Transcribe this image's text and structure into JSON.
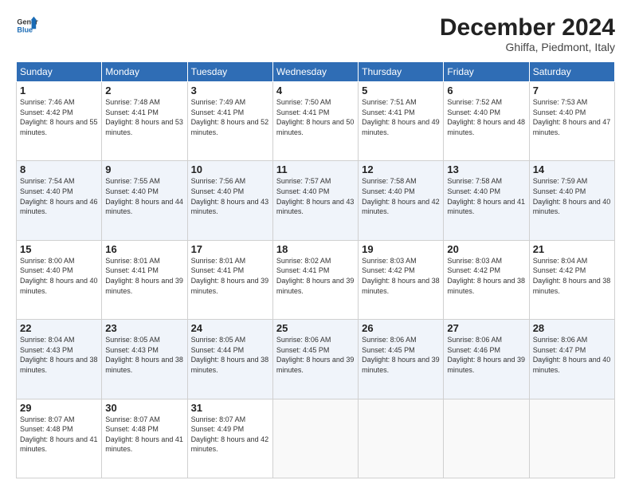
{
  "header": {
    "logo_line1": "General",
    "logo_line2": "Blue",
    "title": "December 2024",
    "subtitle": "Ghiffa, Piedmont, Italy"
  },
  "days_of_week": [
    "Sunday",
    "Monday",
    "Tuesday",
    "Wednesday",
    "Thursday",
    "Friday",
    "Saturday"
  ],
  "weeks": [
    [
      {
        "num": "1",
        "sunrise": "7:46 AM",
        "sunset": "4:42 PM",
        "daylight": "8 hours and 55 minutes."
      },
      {
        "num": "2",
        "sunrise": "7:48 AM",
        "sunset": "4:41 PM",
        "daylight": "8 hours and 53 minutes."
      },
      {
        "num": "3",
        "sunrise": "7:49 AM",
        "sunset": "4:41 PM",
        "daylight": "8 hours and 52 minutes."
      },
      {
        "num": "4",
        "sunrise": "7:50 AM",
        "sunset": "4:41 PM",
        "daylight": "8 hours and 50 minutes."
      },
      {
        "num": "5",
        "sunrise": "7:51 AM",
        "sunset": "4:41 PM",
        "daylight": "8 hours and 49 minutes."
      },
      {
        "num": "6",
        "sunrise": "7:52 AM",
        "sunset": "4:40 PM",
        "daylight": "8 hours and 48 minutes."
      },
      {
        "num": "7",
        "sunrise": "7:53 AM",
        "sunset": "4:40 PM",
        "daylight": "8 hours and 47 minutes."
      }
    ],
    [
      {
        "num": "8",
        "sunrise": "7:54 AM",
        "sunset": "4:40 PM",
        "daylight": "8 hours and 46 minutes."
      },
      {
        "num": "9",
        "sunrise": "7:55 AM",
        "sunset": "4:40 PM",
        "daylight": "8 hours and 44 minutes."
      },
      {
        "num": "10",
        "sunrise": "7:56 AM",
        "sunset": "4:40 PM",
        "daylight": "8 hours and 43 minutes."
      },
      {
        "num": "11",
        "sunrise": "7:57 AM",
        "sunset": "4:40 PM",
        "daylight": "8 hours and 43 minutes."
      },
      {
        "num": "12",
        "sunrise": "7:58 AM",
        "sunset": "4:40 PM",
        "daylight": "8 hours and 42 minutes."
      },
      {
        "num": "13",
        "sunrise": "7:58 AM",
        "sunset": "4:40 PM",
        "daylight": "8 hours and 41 minutes."
      },
      {
        "num": "14",
        "sunrise": "7:59 AM",
        "sunset": "4:40 PM",
        "daylight": "8 hours and 40 minutes."
      }
    ],
    [
      {
        "num": "15",
        "sunrise": "8:00 AM",
        "sunset": "4:40 PM",
        "daylight": "8 hours and 40 minutes."
      },
      {
        "num": "16",
        "sunrise": "8:01 AM",
        "sunset": "4:41 PM",
        "daylight": "8 hours and 39 minutes."
      },
      {
        "num": "17",
        "sunrise": "8:01 AM",
        "sunset": "4:41 PM",
        "daylight": "8 hours and 39 minutes."
      },
      {
        "num": "18",
        "sunrise": "8:02 AM",
        "sunset": "4:41 PM",
        "daylight": "8 hours and 39 minutes."
      },
      {
        "num": "19",
        "sunrise": "8:03 AM",
        "sunset": "4:42 PM",
        "daylight": "8 hours and 38 minutes."
      },
      {
        "num": "20",
        "sunrise": "8:03 AM",
        "sunset": "4:42 PM",
        "daylight": "8 hours and 38 minutes."
      },
      {
        "num": "21",
        "sunrise": "8:04 AM",
        "sunset": "4:42 PM",
        "daylight": "8 hours and 38 minutes."
      }
    ],
    [
      {
        "num": "22",
        "sunrise": "8:04 AM",
        "sunset": "4:43 PM",
        "daylight": "8 hours and 38 minutes."
      },
      {
        "num": "23",
        "sunrise": "8:05 AM",
        "sunset": "4:43 PM",
        "daylight": "8 hours and 38 minutes."
      },
      {
        "num": "24",
        "sunrise": "8:05 AM",
        "sunset": "4:44 PM",
        "daylight": "8 hours and 38 minutes."
      },
      {
        "num": "25",
        "sunrise": "8:06 AM",
        "sunset": "4:45 PM",
        "daylight": "8 hours and 39 minutes."
      },
      {
        "num": "26",
        "sunrise": "8:06 AM",
        "sunset": "4:45 PM",
        "daylight": "8 hours and 39 minutes."
      },
      {
        "num": "27",
        "sunrise": "8:06 AM",
        "sunset": "4:46 PM",
        "daylight": "8 hours and 39 minutes."
      },
      {
        "num": "28",
        "sunrise": "8:06 AM",
        "sunset": "4:47 PM",
        "daylight": "8 hours and 40 minutes."
      }
    ],
    [
      {
        "num": "29",
        "sunrise": "8:07 AM",
        "sunset": "4:48 PM",
        "daylight": "8 hours and 41 minutes."
      },
      {
        "num": "30",
        "sunrise": "8:07 AM",
        "sunset": "4:48 PM",
        "daylight": "8 hours and 41 minutes."
      },
      {
        "num": "31",
        "sunrise": "8:07 AM",
        "sunset": "4:49 PM",
        "daylight": "8 hours and 42 minutes."
      },
      null,
      null,
      null,
      null
    ]
  ]
}
